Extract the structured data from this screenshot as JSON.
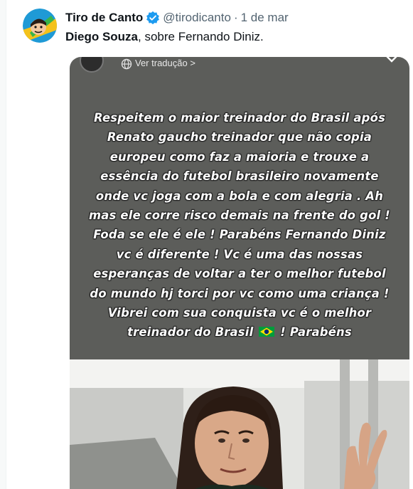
{
  "author": {
    "name": "Tiro de Canto",
    "handle": "@tirodicanto",
    "separator": "·",
    "date": "1 de mar"
  },
  "tweet": {
    "bold_text": "Diego Souza",
    "text": ", sobre Fernando Diniz."
  },
  "story": {
    "translate_label": "Ver tradução",
    "translate_chevron": ">",
    "lines": [
      "Respeitem o maior treinador do Brasil após",
      "Renato gaucho treinador que não copia",
      "europeu como faz a maioria e trouxe a",
      "essência do futebol brasileiro novamente",
      "onde vc joga com a bola e com alegria . Ah",
      "mas ele corre risco demais na frente do gol !",
      "Foda se ele é ele ! Parabéns  Fernando Diniz",
      "vc é diferente ! Vc é uma das nossas",
      "esperanças de voltar a ter o melhor futebol",
      "do mundo hj torci por vc como uma criança !",
      "Vibrei com sua conquista  vc é o melhor"
    ],
    "last_line_before": "treinador do Brasil",
    "last_line_after": "! Parabéns"
  },
  "colors": {
    "verified_blue": "#1d9bf0",
    "story_bg": "#5c5d5a",
    "flag_green": "#009c3b",
    "flag_yellow": "#ffdf00",
    "flag_blue": "#002776"
  },
  "icons": {
    "verified": "verified-badge-icon",
    "translate": "globe-icon",
    "close": "close-icon",
    "flag": "brazil-flag-icon"
  }
}
